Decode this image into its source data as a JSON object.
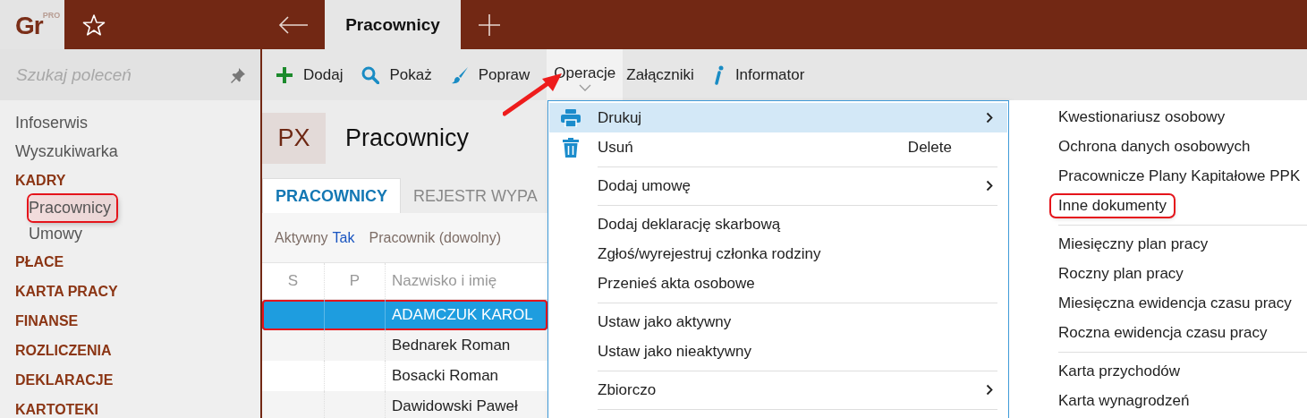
{
  "app": {
    "logo": "Gr",
    "logo_badge": "PRO"
  },
  "tabs": [
    {
      "label": "Pracownicy",
      "selected": true
    }
  ],
  "sidebar": {
    "search": {
      "placeholder": "Szukaj poleceń"
    },
    "items": [
      {
        "kind": "link",
        "label": "Infoserwis"
      },
      {
        "kind": "link",
        "label": "Wyszukiwarka"
      },
      {
        "kind": "section",
        "label": "KADRY",
        "children": [
          {
            "label": "Pracownicy",
            "selected": true,
            "annotated": true
          },
          {
            "label": "Umowy",
            "selected": false,
            "annotated": false
          }
        ]
      },
      {
        "kind": "section",
        "label": "PŁACE"
      },
      {
        "kind": "section",
        "label": "KARTA PRACY"
      },
      {
        "kind": "section",
        "label": "FINANSE"
      },
      {
        "kind": "section",
        "label": "ROZLICZENIA"
      },
      {
        "kind": "section",
        "label": "DEKLARACJE"
      },
      {
        "kind": "section",
        "label": "KARTOTEKI"
      }
    ]
  },
  "toolbar": [
    {
      "kind": "add",
      "label": "Dodaj"
    },
    {
      "kind": "show",
      "label": "Pokaż"
    },
    {
      "kind": "edit",
      "label": "Popraw"
    },
    {
      "kind": "dropdown",
      "label": "Operacje",
      "open": true
    },
    {
      "kind": "plain",
      "label": "Załączniki"
    },
    {
      "kind": "info",
      "label": "Informator"
    }
  ],
  "page": {
    "badge": "PX",
    "title": "Pracownicy",
    "tabs": [
      {
        "label": "PRACOWNICY",
        "selected": true
      },
      {
        "label": "REJESTR WYPA",
        "selected": false
      }
    ],
    "filters": [
      {
        "label": "Aktywny",
        "value": "Tak"
      },
      {
        "label": "Pracownik (dowolny)"
      }
    ],
    "table": {
      "columns": [
        "S",
        "P",
        "Nazwisko i imię"
      ],
      "rows": [
        {
          "name": "ADAMCZUK KAROL",
          "selected": true,
          "annotated": true
        },
        {
          "name": "Bednarek Roman",
          "selected": false,
          "annotated": false
        },
        {
          "name": "Bosacki Roman",
          "selected": false,
          "annotated": false
        },
        {
          "name": "Dawidowski Paweł",
          "selected": false,
          "annotated": false
        }
      ]
    }
  },
  "menu": {
    "items": [
      {
        "kind": "print",
        "label": "Drukuj",
        "selected": true,
        "submenu": true
      },
      {
        "kind": "delete",
        "label": "Usuń",
        "shortcut": "Delete",
        "selected": false,
        "submenu": false
      },
      {
        "kind": "separator"
      },
      {
        "kind": "item",
        "label": "Dodaj umowę",
        "selected": false,
        "submenu": true
      },
      {
        "kind": "separator"
      },
      {
        "kind": "item",
        "label": "Dodaj deklarację skarbową",
        "selected": false,
        "submenu": false
      },
      {
        "kind": "item",
        "label": "Zgłoś/wyrejestruj członka rodziny",
        "selected": false,
        "submenu": false
      },
      {
        "kind": "item",
        "label": "Przenieś akta osobowe",
        "selected": false,
        "submenu": false
      },
      {
        "kind": "separator"
      },
      {
        "kind": "item",
        "label": "Ustaw jako aktywny",
        "selected": false,
        "submenu": false
      },
      {
        "kind": "item",
        "label": "Ustaw jako nieaktywny",
        "selected": false,
        "submenu": false
      },
      {
        "kind": "separator"
      },
      {
        "kind": "item",
        "label": "Zbiorczo",
        "selected": false,
        "submenu": true
      },
      {
        "kind": "separator"
      }
    ]
  },
  "submenu": {
    "items": [
      {
        "kind": "item",
        "label": "Kwestionariusz osobowy",
        "annotated": false
      },
      {
        "kind": "item",
        "label": "Ochrona danych osobowych",
        "annotated": false
      },
      {
        "kind": "item",
        "label": "Pracownicze Plany Kapitałowe PPK",
        "annotated": false
      },
      {
        "kind": "item",
        "label": "Inne dokumenty",
        "annotated": true
      },
      {
        "kind": "separator"
      },
      {
        "kind": "item",
        "label": "Miesięczny plan pracy",
        "annotated": false
      },
      {
        "kind": "item",
        "label": "Roczny plan pracy",
        "annotated": false
      },
      {
        "kind": "item",
        "label": "Miesięczna ewidencja czasu pracy",
        "annotated": false
      },
      {
        "kind": "item",
        "label": "Roczna ewidencja czasu pracy",
        "annotated": false
      },
      {
        "kind": "separator"
      },
      {
        "kind": "item",
        "label": "Karta przychodów",
        "annotated": false
      },
      {
        "kind": "item",
        "label": "Karta wynagrodzeń",
        "annotated": false
      }
    ]
  }
}
